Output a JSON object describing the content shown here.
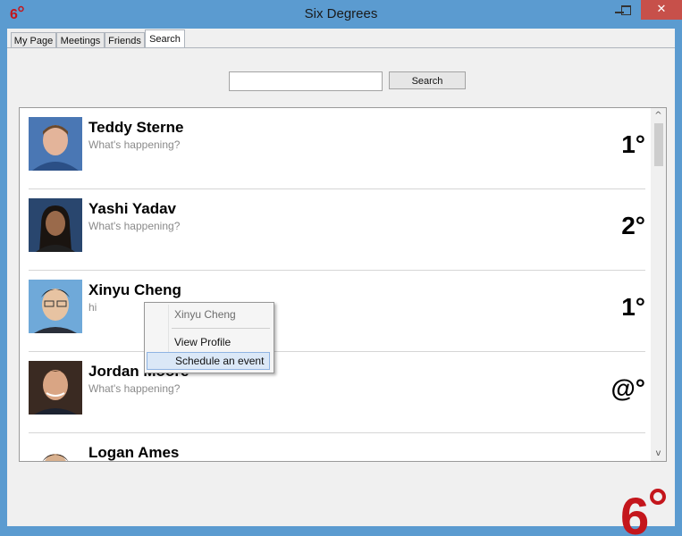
{
  "window": {
    "title": "Six Degrees",
    "close_glyph": "✕"
  },
  "tabs": [
    {
      "label": "My Page"
    },
    {
      "label": "Meetings"
    },
    {
      "label": "Friends"
    },
    {
      "label": "Search",
      "active": true
    }
  ],
  "search": {
    "value": "",
    "placeholder": "",
    "button_label": "Search"
  },
  "results": [
    {
      "name": "Teddy Sterne",
      "status": "What's happening?",
      "degree": "1°",
      "avatar": "person-photo"
    },
    {
      "name": "Yashi Yadav",
      "status": "What's happening?",
      "degree": "2°",
      "avatar": "person-photo"
    },
    {
      "name": "Xinyu Cheng",
      "status": "hi",
      "degree": "1°",
      "avatar": "person-photo"
    },
    {
      "name": "Jordan Moore",
      "status": "What's happening?",
      "degree": "@°",
      "avatar": "person-photo"
    },
    {
      "name": "Logan Ames",
      "status": "",
      "degree": "",
      "avatar": "person-photo"
    }
  ],
  "context_menu": {
    "header": "Xinyu Cheng",
    "items": [
      {
        "label": "View Profile"
      },
      {
        "label": "Schedule an event",
        "highlighted": true
      }
    ]
  },
  "scrollbar": {
    "up_glyph": "^",
    "down_glyph": "v"
  },
  "colors": {
    "titlebar": "#5b9bd0",
    "close": "#c7504a",
    "logo": "#c4161c",
    "menu_highlight": "#dbe8f7"
  }
}
